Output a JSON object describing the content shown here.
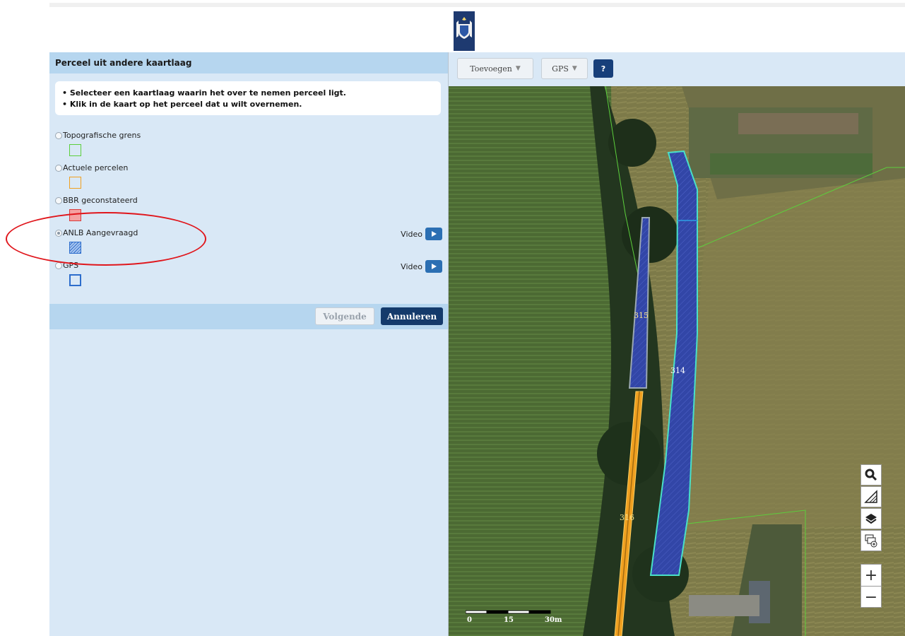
{
  "panel": {
    "title": "Perceel uit andere kaartlaag",
    "instructions": [
      "Selecteer een kaartlaag waarin het over te nemen perceel ligt.",
      "Klik in de kaart op het perceel dat u wilt overnemen."
    ],
    "layers": [
      {
        "label": "Topografische grens",
        "selected": false,
        "video": null
      },
      {
        "label": "Actuele percelen",
        "selected": false,
        "video": null
      },
      {
        "label": "BBR geconstateerd",
        "selected": false,
        "video": null
      },
      {
        "label": "ANLB Aangevraagd",
        "selected": true,
        "video": "Video"
      },
      {
        "label": "GPS",
        "selected": false,
        "video": "Video"
      }
    ],
    "buttons": {
      "next": "Volgende",
      "cancel": "Annuleren"
    }
  },
  "map": {
    "toolbar": {
      "add": "Toevoegen",
      "gps": "GPS",
      "help": "?"
    },
    "parcels": {
      "p314": "314",
      "p315": "315",
      "p316": "316"
    },
    "scale": {
      "start": "0",
      "mid": "15",
      "end": "30m"
    }
  },
  "colors": {
    "panel_bg": "#d9e8f6",
    "panel_header": "#b6d6ef",
    "primary_button": "#143a6b",
    "annotation": "#e0161c",
    "parcel_fill": "#3b4fb0",
    "parcel_border": "#49e0c8",
    "line_orange": "#f0a020",
    "topo_green": "#5ccf3c"
  }
}
